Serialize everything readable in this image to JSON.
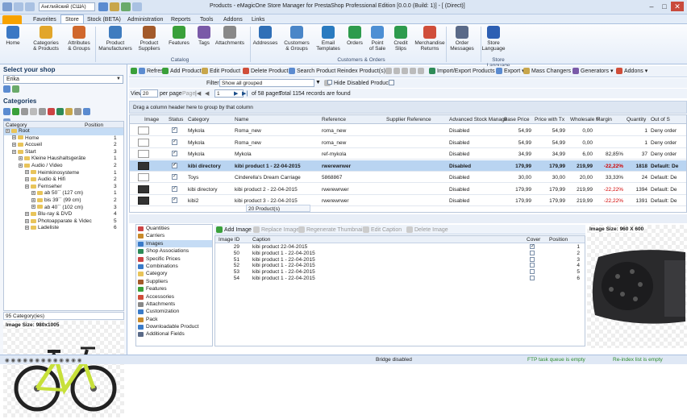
{
  "window": {
    "title": "Products - eMagicOne Store Manager for PrestaShop Professional Edition [0.0.0 (Build: 1)] - [                    (Direct)]",
    "language": "Английский (США)"
  },
  "menu": {
    "tabs": [
      "Favorites",
      "Store",
      "Stock (BETA)",
      "Administration",
      "Reports",
      "Tools",
      "Addons",
      "Links"
    ],
    "active": "Store"
  },
  "ribbon": {
    "buttons": [
      {
        "label": "Home",
        "color": "#3b78c4"
      },
      {
        "label": "Categories\n& Products",
        "color": "#e2a62a"
      },
      {
        "label": "Attributes\n& Groups",
        "color": "#d0682c"
      },
      {
        "label": "Product\nManufacturers",
        "color": "#3f7cbf"
      },
      {
        "label": "Product\nSuppliers",
        "color": "#a35a2a"
      },
      {
        "label": "Features",
        "color": "#3aa03a"
      },
      {
        "label": "Tags",
        "color": "#7a5aa8"
      },
      {
        "label": "Attachments",
        "color": "#888888"
      },
      {
        "label": "Addresses",
        "color": "#2f6fb7"
      },
      {
        "label": "Customers\n& Groups",
        "color": "#4a86c8"
      },
      {
        "label": "Email\nTemplates",
        "color": "#2a7bc0"
      },
      {
        "label": "Orders",
        "color": "#2e9b4d"
      },
      {
        "label": "Point\nof Sale",
        "color": "#4d8fd4"
      },
      {
        "label": "Credit\nSlips",
        "color": "#2e9b4d"
      },
      {
        "label": "Merchandise\nReturns",
        "color": "#d04e3a"
      },
      {
        "label": "Order\nMessages",
        "color": "#5a6a88"
      },
      {
        "label": "Store\nLanguage",
        "color": "#2d5fb3"
      }
    ],
    "groups": [
      "Catalog",
      "Customers & Orders",
      "Store Language"
    ]
  },
  "shop": {
    "header": "Select your shop",
    "selected": "Erika"
  },
  "categories": {
    "header": "Categories",
    "columns": [
      "Category",
      "Position"
    ],
    "rows": [
      {
        "label": "Root",
        "level": 0,
        "pos": "",
        "sel": true
      },
      {
        "label": "Home",
        "level": 1,
        "pos": "1"
      },
      {
        "label": "Accueil",
        "level": 1,
        "pos": "2"
      },
      {
        "label": "Start",
        "level": 1,
        "pos": "3"
      },
      {
        "label": "Kleine Haushaltsgeräte",
        "level": 2,
        "pos": "1"
      },
      {
        "label": "Audio / Video",
        "level": 2,
        "pos": "2"
      },
      {
        "label": "Heimkinosysteme",
        "level": 3,
        "pos": "1"
      },
      {
        "label": "Audio & Hifi",
        "level": 3,
        "pos": "2"
      },
      {
        "label": "Fernseher",
        "level": 3,
        "pos": "3"
      },
      {
        "label": "ab 50´´ (127 cm)",
        "level": 4,
        "pos": "1"
      },
      {
        "label": "bis 39´´ (99 cm)",
        "level": 4,
        "pos": "2"
      },
      {
        "label": "ab 40´´ (102 cm)",
        "level": 4,
        "pos": "3"
      },
      {
        "label": "Blu-ray & DVD",
        "level": 3,
        "pos": "4"
      },
      {
        "label": "Photoapparate & Videc",
        "level": 3,
        "pos": "5"
      },
      {
        "label": "Ladeliste",
        "level": 3,
        "pos": "6"
      }
    ],
    "count": "95 Category(ies)",
    "image_size": "Image Size: 980x1005"
  },
  "toolbar": {
    "refresh": "Refresh",
    "add": "Add Product",
    "edit": "Edit Product",
    "delete": "Delete Product",
    "search": "Search Product",
    "reindex": "Reindex Product(s)",
    "import_export": "Import/Export Products",
    "export": "Export",
    "mass_changers": "Mass Changers",
    "generators": "Generators",
    "addons": "Addons"
  },
  "filter": {
    "label": "Filter",
    "value": "Show all grouped",
    "hide_disabled": "Hide Disabled Products"
  },
  "paging": {
    "view_label": "View",
    "per_page_value": "20",
    "per_page_label": "per page",
    "page_label": "Page",
    "page_value": "1",
    "of_pages": "of 58 pages",
    "total": "Total 1154 records are found"
  },
  "group_hint": "Drag a column header here to group by that column",
  "grid": {
    "columns": [
      "Image",
      "Status",
      "Category",
      "Name",
      "Reference",
      "Supplier Reference",
      "Advanced Stock Manage",
      "Base Price",
      "Price with Tx",
      "Wholesale F",
      "Margin",
      "Quantity",
      "Out of S"
    ],
    "rows": [
      {
        "img": "light",
        "status": true,
        "category": "Mykola",
        "name": "Roma_new",
        "reference": "roma_new",
        "supref": "",
        "adv": "Disabled",
        "base": "54,99",
        "price": "54,99",
        "wholesale": "0,00",
        "margin": "",
        "qty": "1",
        "oos": "Deny order"
      },
      {
        "img": "light",
        "status": true,
        "category": "Mykola",
        "name": "Roma_new",
        "reference": "roma_new",
        "supref": "",
        "adv": "Disabled",
        "base": "54,99",
        "price": "54,99",
        "wholesale": "0,00",
        "margin": "",
        "qty": "1",
        "oos": "Deny order"
      },
      {
        "img": "light",
        "status": true,
        "category": "Mykola",
        "name": "Mykola",
        "reference": "ref-mykola",
        "supref": "",
        "adv": "Disabled",
        "base": "34,99",
        "price": "34,99",
        "wholesale": "6,00",
        "margin": "82,85%",
        "qty": "37",
        "oos": "Deny order"
      },
      {
        "img": "dark",
        "status": true,
        "category": "kibi directory",
        "name": "kibi product 1 - 22-04-2015",
        "reference": "rwerewrwer",
        "supref": "",
        "adv": "Disabled",
        "base": "179,99",
        "price": "179,99",
        "wholesale": "219,99",
        "margin": "-22,22%",
        "qty": "1818",
        "oos": "Default: De",
        "sel": true
      },
      {
        "img": "light",
        "status": true,
        "category": "Toys",
        "name": "Cinderella's Dream Carriage",
        "reference": "5868867",
        "supref": "",
        "adv": "Disabled",
        "base": "30,00",
        "price": "30,00",
        "wholesale": "20,00",
        "margin": "33,33%",
        "qty": "24",
        "oos": "Default: De"
      },
      {
        "img": "dark",
        "status": true,
        "category": "kibi directory",
        "name": "kibi product 2 - 22-04-2015",
        "reference": "rwerewrwer",
        "supref": "",
        "adv": "Disabled",
        "base": "179,99",
        "price": "179,99",
        "wholesale": "219,99",
        "margin": "-22,22%",
        "qty": "1394",
        "oos": "Default: De"
      },
      {
        "img": "dark",
        "status": true,
        "category": "kibi2",
        "name": "kibi product 3 - 22-04-2015",
        "reference": "rwerewrwer",
        "supref": "",
        "adv": "Disabled",
        "base": "179,99",
        "price": "179,99",
        "wholesale": "219,99",
        "margin": "-22,22%",
        "qty": "1391",
        "oos": "Default: De"
      }
    ],
    "footer": "20 Product(s)"
  },
  "detail_nav": {
    "items": [
      {
        "label": "Quantities",
        "color": "#c44"
      },
      {
        "label": "Carriers",
        "color": "#c88a2a"
      },
      {
        "label": "Images",
        "color": "#3a7bc8",
        "sel": true
      },
      {
        "label": "Shop Associations",
        "color": "#2e8b57"
      },
      {
        "label": "Specific Prices",
        "color": "#c44"
      },
      {
        "label": "Combinations",
        "color": "#3a7bc8"
      },
      {
        "label": "Category",
        "color": "#e8c45a"
      },
      {
        "label": "Suppliers",
        "color": "#a35a2a"
      },
      {
        "label": "Features",
        "color": "#3aa03a"
      },
      {
        "label": "Accessories",
        "color": "#d04e3a"
      },
      {
        "label": "Attachments",
        "color": "#888"
      },
      {
        "label": "Customization",
        "color": "#3a7bc8"
      },
      {
        "label": "Pack",
        "color": "#c88a2a"
      },
      {
        "label": "Downloadable Product",
        "color": "#3a7bc8"
      },
      {
        "label": "Additional Fields",
        "color": "#5a6a88"
      }
    ]
  },
  "image_tools": {
    "add": "Add Image",
    "replace": "Replace Image",
    "regenerate": "Regenerate Thumbnails",
    "edit_caption": "Edit Caption",
    "delete": "Delete Image"
  },
  "images": {
    "columns": [
      "Image ID",
      "Caption",
      "Cover",
      "Position"
    ],
    "rows": [
      {
        "id": "29",
        "caption": "kibi product 22-04-2015",
        "cover": true,
        "pos": "1"
      },
      {
        "id": "50",
        "caption": "kibi product 1 - 22-04-2015",
        "cover": false,
        "pos": "2"
      },
      {
        "id": "51",
        "caption": "kibi product 1 - 22-04-2015",
        "cover": false,
        "pos": "3"
      },
      {
        "id": "52",
        "caption": "kibi product 1 - 22-04-2015",
        "cover": false,
        "pos": "4"
      },
      {
        "id": "53",
        "caption": "kibi product 1 - 22-04-2015",
        "cover": false,
        "pos": "5"
      },
      {
        "id": "54",
        "caption": "kibi product 1 - 22-04-2015",
        "cover": false,
        "pos": "6"
      }
    ],
    "preview_size": "Image Size: 960 X 600"
  },
  "status": {
    "bridge": "Bridge disabled",
    "ftp": "FTP task queue is empty",
    "reindex": "Re-index list is empty"
  }
}
